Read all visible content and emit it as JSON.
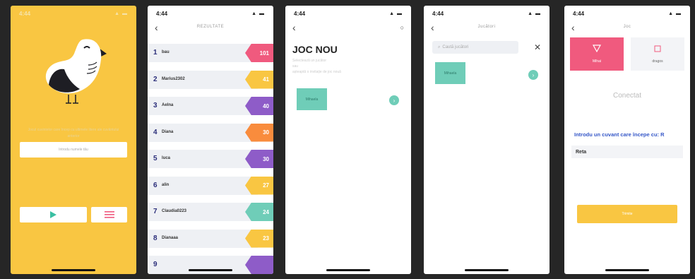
{
  "colors": {
    "yellow": "#F9C642",
    "navy": "#2B2E7A",
    "teal": "#6FCDB8",
    "pink": "#F05A7E",
    "orange": "#F98C3D",
    "purple": "#8E5CC8",
    "blue": "#3557C8"
  },
  "statusbar": {
    "time": "4:44",
    "icons": "▲ ▬"
  },
  "home": {
    "tagline": "Jocul cuvintelor care încep cu ultimele litere ale cuvântului anterior",
    "name_placeholder": "Introdu numele tău",
    "play_icon": "play-icon",
    "menu_icon": "menu-icon"
  },
  "results": {
    "title": "REZULTATE",
    "rows": [
      {
        "rank": "1",
        "name": "bau",
        "score": "101",
        "color": "#F05A7E"
      },
      {
        "rank": "2",
        "name": "Marius2302",
        "score": "41",
        "color": "#F9C642"
      },
      {
        "rank": "3",
        "name": "Aelna",
        "score": "40",
        "color": "#8E5CC8"
      },
      {
        "rank": "4",
        "name": "Diana",
        "score": "30",
        "color": "#F98C3D"
      },
      {
        "rank": "5",
        "name": "luca",
        "score": "30",
        "color": "#8E5CC8"
      },
      {
        "rank": "6",
        "name": "alin",
        "score": "27",
        "color": "#F9C642"
      },
      {
        "rank": "7",
        "name": "Claudia0223",
        "score": "24",
        "color": "#6FCDB8"
      },
      {
        "rank": "8",
        "name": "Dianaaa",
        "score": "23",
        "color": "#F9C642"
      },
      {
        "rank": "9",
        "name": "",
        "score": "",
        "color": "#8E5CC8"
      }
    ]
  },
  "newgame": {
    "title": "JOC NOU",
    "lines": [
      "Selectează un jucător",
      "sau",
      "așteaptă o invitație de joc nouă"
    ],
    "card_label": "Mihaela",
    "action_icon": "arrow-icon"
  },
  "search": {
    "title": "Jucători",
    "placeholder": "Caută jucători",
    "card_label": "Mihaela",
    "close": "✕"
  },
  "game": {
    "title": "Joc",
    "mode_a": "Mihai",
    "mode_b": "dragos",
    "status": "Conectat",
    "prompt": "Introdu un cuvant care începe cu: R",
    "input_value": "Reta",
    "submit": "Trimite"
  }
}
